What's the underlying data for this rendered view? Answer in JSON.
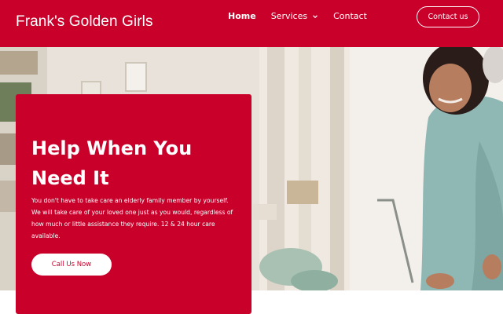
{
  "header": {
    "brand": "Frank's Golden Girls",
    "nav": [
      {
        "label": "Home",
        "active": true
      },
      {
        "label": "Services",
        "dropdown": true
      },
      {
        "label": "Contact"
      }
    ],
    "cta_label": "Contact us"
  },
  "hero": {
    "title": "Help When You Need It",
    "text": "You don't have to take care an elderly family member by yourself. We will take care of your loved one just as you would, regardless of how much or little assistance they require. 12 & 24 hour care available.",
    "button_label": "Call Us Now"
  },
  "colors": {
    "brand_red": "#c8002a",
    "white": "#ffffff"
  }
}
